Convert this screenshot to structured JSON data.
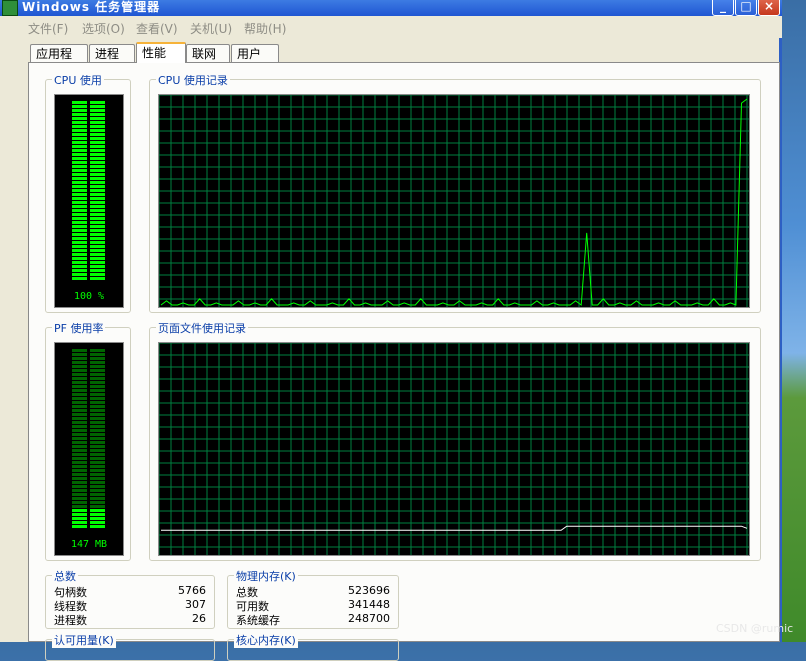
{
  "window": {
    "title": "Windows 任务管理器",
    "controls": [
      "_",
      "□",
      "×"
    ]
  },
  "menu": [
    "文件(F)",
    "选项(O)",
    "查看(V)",
    "关机(U)",
    "帮助(H)"
  ],
  "tabs": [
    {
      "label": "应用程序",
      "active": false
    },
    {
      "label": "进程",
      "active": false
    },
    {
      "label": "性能",
      "active": true
    },
    {
      "label": "联网",
      "active": false
    },
    {
      "label": "用户",
      "active": false
    }
  ],
  "cpu_usage": {
    "label": "CPU 使用",
    "value_text": "100 %",
    "level": 1.0
  },
  "cpu_history": {
    "label": "CPU 使用记录",
    "line_color": "#00ff00",
    "grid_color": "#008040",
    "samples": [
      0,
      2,
      0,
      0,
      1,
      0,
      0,
      3,
      0,
      0,
      1,
      0,
      0,
      0,
      2,
      0,
      0,
      1,
      0,
      0,
      3,
      0,
      0,
      0,
      1,
      0,
      0,
      2,
      0,
      0,
      0,
      1,
      0,
      0,
      3,
      0,
      0,
      1,
      0,
      0,
      0,
      2,
      0,
      0,
      1,
      0,
      0,
      3,
      0,
      0,
      0,
      1,
      0,
      0,
      2,
      0,
      0,
      0,
      1,
      0,
      0,
      3,
      0,
      0,
      1,
      0,
      0,
      0,
      2,
      0,
      0,
      1,
      0,
      0,
      0,
      2,
      0,
      35,
      0,
      0,
      3,
      0,
      0,
      1,
      0,
      0,
      2,
      0,
      0,
      0,
      1,
      0,
      0,
      2,
      0,
      0,
      0,
      1,
      0,
      0,
      3,
      0,
      0,
      1,
      0,
      98,
      100
    ]
  },
  "pf_usage": {
    "label": "PF 使用率",
    "value_text": "147 MB",
    "level": 0.12
  },
  "pf_history": {
    "label": "页面文件使用记录",
    "line_color": "#ffffff",
    "samples": [
      0.11,
      0.11,
      0.11,
      0.11,
      0.11,
      0.11,
      0.11,
      0.11,
      0.11,
      0.11,
      0.11,
      0.11,
      0.11,
      0.11,
      0.11,
      0.11,
      0.11,
      0.11,
      0.11,
      0.11,
      0.11,
      0.11,
      0.11,
      0.11,
      0.11,
      0.11,
      0.11,
      0.11,
      0.11,
      0.11,
      0.11,
      0.11,
      0.11,
      0.11,
      0.11,
      0.11,
      0.11,
      0.11,
      0.11,
      0.11,
      0.11,
      0.11,
      0.11,
      0.11,
      0.11,
      0.11,
      0.11,
      0.11,
      0.11,
      0.11,
      0.11,
      0.11,
      0.11,
      0.11,
      0.11,
      0.11,
      0.11,
      0.11,
      0.11,
      0.11,
      0.11,
      0.11,
      0.11,
      0.11,
      0.11,
      0.11,
      0.11,
      0.11,
      0.11,
      0.11,
      0.11,
      0.11,
      0.13,
      0.13,
      0.13,
      0.13,
      0.13,
      0.13,
      0.13,
      0.13,
      0.13,
      0.13,
      0.13,
      0.13,
      0.13,
      0.13,
      0.13,
      0.13,
      0.13,
      0.13,
      0.13,
      0.13,
      0.13,
      0.13,
      0.13,
      0.13,
      0.13,
      0.13,
      0.13,
      0.13,
      0.13,
      0.13,
      0.13,
      0.13,
      0.12
    ]
  },
  "totals": {
    "label": "总数",
    "rows": [
      {
        "k": "句柄数",
        "v": "5766"
      },
      {
        "k": "线程数",
        "v": "307"
      },
      {
        "k": "进程数",
        "v": "26"
      }
    ]
  },
  "physical": {
    "label": "物理内存(K)",
    "rows": [
      {
        "k": "总数",
        "v": "523696"
      },
      {
        "k": "可用数",
        "v": "341448"
      },
      {
        "k": "系统缓存",
        "v": "248700"
      }
    ]
  },
  "commit": {
    "label": "认可用量(K)"
  },
  "kernel": {
    "label": "核心内存(K)"
  },
  "watermark": "CSDN @rumic"
}
